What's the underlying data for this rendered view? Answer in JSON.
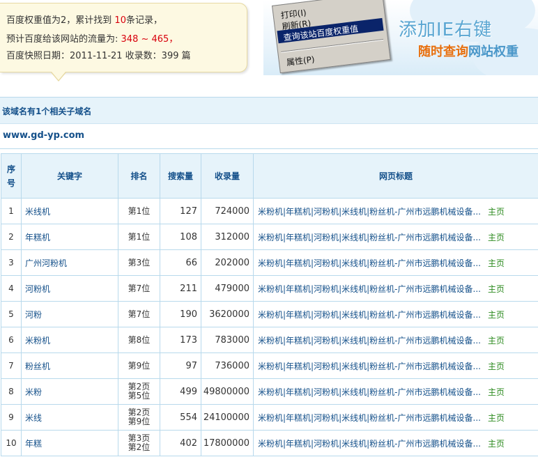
{
  "info": {
    "line1_a": "百度权重值为2，累计找到",
    "line1_count": "10",
    "line1_b": "条记录，",
    "line2_a": "预计百度给该网站的流量为:",
    "line2_range": "348 ~ 465",
    "line2_b": "，",
    "line3": "百度快照日期：2011-11-21 收录数：399 篇"
  },
  "banner": {
    "menu_items": [
      "打印(I)",
      "刷新(R)",
      "查询该站百度权重值",
      "属性(P)"
    ],
    "title": "添加IE右键",
    "sub_o": "随时查询",
    "sub_b": "网站权重"
  },
  "subdomain": {
    "heading": "该域名有1个相关子域名",
    "domain": "www.gd-yp.com"
  },
  "table": {
    "headers": {
      "no_1": "序",
      "no_2": "号",
      "keyword": "关键字",
      "rank": "排名",
      "search": "搜索量",
      "indexed": "收录量",
      "title": "网页标题"
    },
    "rows": [
      {
        "no": "1",
        "keyword": "米线机",
        "rank1": "第1位",
        "rank2": "",
        "search": "127",
        "indexed": "724000",
        "title": "米粉机|年糕机|河粉机|米线机|粉丝机-广州市远鹏机械设备...",
        "home": "主页"
      },
      {
        "no": "2",
        "keyword": "年糕机",
        "rank1": "第1位",
        "rank2": "",
        "search": "108",
        "indexed": "312000",
        "title": "米粉机|年糕机|河粉机|米线机|粉丝机-广州市远鹏机械设备...",
        "home": "主页"
      },
      {
        "no": "3",
        "keyword": "广州河粉机",
        "rank1": "第3位",
        "rank2": "",
        "search": "66",
        "indexed": "202000",
        "title": "米粉机|年糕机|河粉机|米线机|粉丝机-广州市远鹏机械设备...",
        "home": "主页"
      },
      {
        "no": "4",
        "keyword": "河粉机",
        "rank1": "第7位",
        "rank2": "",
        "search": "211",
        "indexed": "479000",
        "title": "米粉机|年糕机|河粉机|米线机|粉丝机-广州市远鹏机械设备...",
        "home": "主页"
      },
      {
        "no": "5",
        "keyword": "河粉",
        "rank1": "第7位",
        "rank2": "",
        "search": "190",
        "indexed": "3620000",
        "title": "米粉机|年糕机|河粉机|米线机|粉丝机-广州市远鹏机械设备...",
        "home": "主页"
      },
      {
        "no": "6",
        "keyword": "米粉机",
        "rank1": "第8位",
        "rank2": "",
        "search": "173",
        "indexed": "783000",
        "title": "米粉机|年糕机|河粉机|米线机|粉丝机-广州市远鹏机械设备...",
        "home": "主页"
      },
      {
        "no": "7",
        "keyword": "粉丝机",
        "rank1": "第9位",
        "rank2": "",
        "search": "97",
        "indexed": "736000",
        "title": "米粉机|年糕机|河粉机|米线机|粉丝机-广州市远鹏机械设备...",
        "home": "主页"
      },
      {
        "no": "8",
        "keyword": "米粉",
        "rank1": "第2页",
        "rank2": "第5位",
        "search": "499",
        "indexed": "49800000",
        "title": "米粉机|年糕机|河粉机|米线机|粉丝机-广州市远鹏机械设备...",
        "home": "主页"
      },
      {
        "no": "9",
        "keyword": "米线",
        "rank1": "第2页",
        "rank2": "第9位",
        "search": "554",
        "indexed": "24100000",
        "title": "米粉机|年糕机|河粉机|米线机|粉丝机-广州市远鹏机械设备...",
        "home": "主页"
      },
      {
        "no": "10",
        "keyword": "年糕",
        "rank1": "第3页",
        "rank2": "第2位",
        "search": "402",
        "indexed": "17800000",
        "title": "米粉机|年糕机|河粉机|米线机|粉丝机-广州市远鹏机械设备...",
        "home": "主页"
      }
    ]
  }
}
